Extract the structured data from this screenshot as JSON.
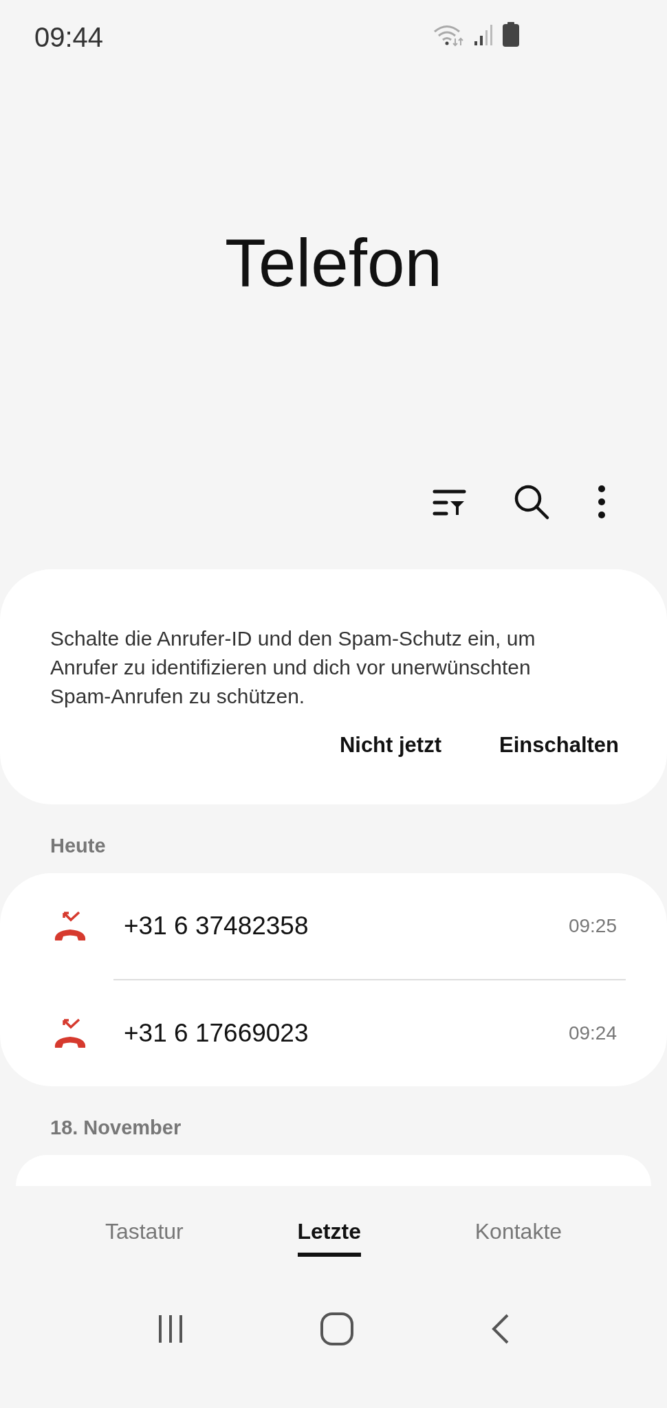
{
  "status_bar": {
    "time": "09:44"
  },
  "title": "Telefon",
  "banner": {
    "message": "Schalte die Anrufer-ID und den Spam-Schutz ein, um Anrufer zu identifizieren und dich vor unerwünschten Spam-Anrufen zu schützen.",
    "buttons": [
      "Nicht jetzt",
      "Einschalten"
    ]
  },
  "groups": [
    {
      "heading": "Heute",
      "calls": [
        {
          "number": "+31 6 37482358",
          "time": "09:25"
        },
        {
          "number": "+31 6 17669023",
          "time": "09:24"
        }
      ]
    },
    {
      "heading": "18. November"
    }
  ],
  "tabs": [
    {
      "label": "Tastatur",
      "selected": false
    },
    {
      "label": "Letzte",
      "selected": true
    },
    {
      "label": "Kontakte",
      "selected": false
    }
  ]
}
